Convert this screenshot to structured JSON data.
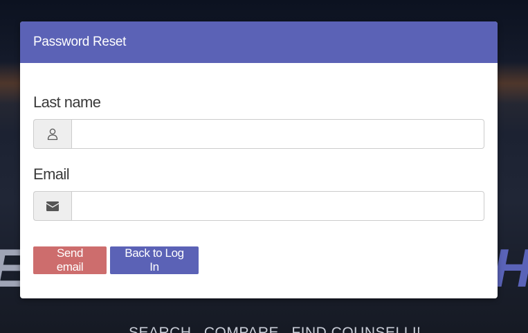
{
  "background": {
    "text_left": "ED",
    "text_right": "H",
    "nav_items": [
      "SEARCH",
      "COMPARE",
      "FIND COUNSELLING"
    ]
  },
  "modal": {
    "title": "Password Reset",
    "last_name": {
      "label": "Last name",
      "value": "",
      "placeholder": "",
      "icon": "user-icon"
    },
    "email": {
      "label": "Email",
      "value": "",
      "placeholder": "",
      "icon": "envelope-icon"
    },
    "send_button": "Send email",
    "back_button": "Back to Log In"
  },
  "colors": {
    "header": "#5b62b6",
    "send_button": "#cd6d6d",
    "back_button": "#5b62b6"
  }
}
